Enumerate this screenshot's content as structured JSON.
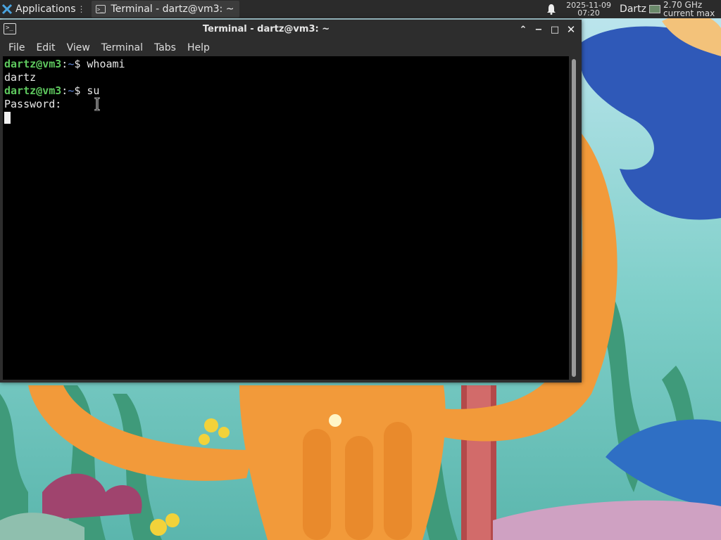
{
  "panel": {
    "apps_label": "Applications",
    "apps_sep": "⋮",
    "task_label": "Terminal - dartz@vm3: ~",
    "clock_date": "2025-11-09",
    "clock_time": "07:20",
    "user": "Dartz",
    "cpu_freq_line1": "2.70 GHz",
    "cpu_freq_line2": "current max"
  },
  "window": {
    "title": "Terminal - dartz@vm3: ~",
    "buttons": {
      "shade": "⌃",
      "minimize": "−",
      "maximize": "□",
      "close": "✕"
    }
  },
  "menu": {
    "items": [
      "File",
      "Edit",
      "View",
      "Terminal",
      "Tabs",
      "Help"
    ]
  },
  "terminal": {
    "lines": [
      {
        "user": "dartz@vm3",
        "colon": ":",
        "path": "~",
        "dollar": "$ ",
        "cmd": "whoami"
      },
      {
        "output": "dartz"
      },
      {
        "user": "dartz@vm3",
        "colon": ":",
        "path": "~",
        "dollar": "$ ",
        "cmd": "su"
      },
      {
        "output": "Password:"
      }
    ]
  },
  "colors": {
    "prompt_user": "#5ec85e",
    "prompt_path": "#5f86d8",
    "terminal_bg": "#000000",
    "panel_bg": "#2b2b2b"
  },
  "icons": [
    "apps-menu-icon",
    "terminal-icon",
    "bell-icon",
    "cpu-graph-icon",
    "text-cursor-icon"
  ]
}
